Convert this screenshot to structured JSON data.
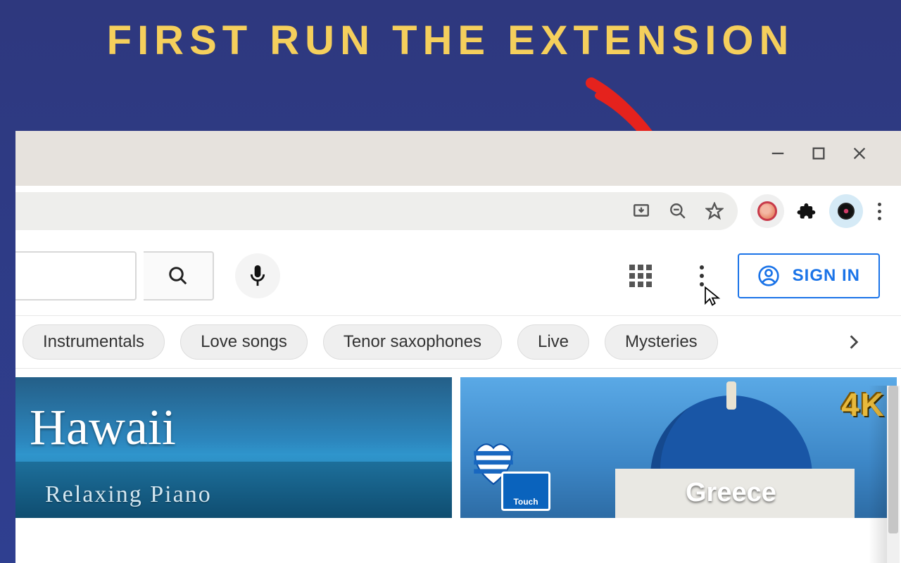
{
  "banner": {
    "text": "FIRST RUN THE EXTENSION"
  },
  "window_controls": {
    "minimize_name": "minimize",
    "maximize_name": "maximize",
    "close_name": "close"
  },
  "toolbar": {
    "install_name": "install-app",
    "zoom_name": "zoom-out",
    "star_name": "bookmark-star",
    "extension_name": "extension-target",
    "extensions_name": "extensions-puzzle",
    "profile_name": "chrome-profile",
    "menu_name": "chrome-menu"
  },
  "yt": {
    "search_name": "search",
    "voice_name": "voice-search",
    "apps_name": "youtube-apps",
    "menu_name": "youtube-menu",
    "signin_label": "SIGN IN"
  },
  "chips": {
    "items": [
      {
        "label": "Instrumentals"
      },
      {
        "label": "Love songs"
      },
      {
        "label": "Tenor saxophones"
      },
      {
        "label": "Live"
      },
      {
        "label": "Mysteries"
      }
    ],
    "scroll_name": "scroll-right"
  },
  "thumbs": {
    "hawaii": {
      "title": "Hawaii",
      "subtitle": "Relaxing Piano"
    },
    "greece": {
      "title": "Greece",
      "badge": "4K",
      "touch_label": "Touch"
    }
  }
}
